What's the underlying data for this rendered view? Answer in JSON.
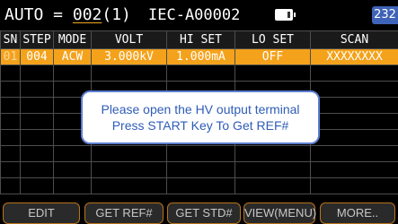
{
  "header": {
    "auto_prefix": "AUTO = ",
    "auto_number": "002",
    "auto_suffix": "(1)",
    "standard": "IEC-A00002",
    "battery_icon": "battery-icon",
    "badge": "232"
  },
  "table": {
    "columns": [
      "SN",
      "STEP",
      "MODE",
      "VOLT",
      "HI SET",
      "LO SET",
      "SCAN"
    ],
    "rows": [
      [
        "01",
        "004",
        "ACW",
        "3.000kV",
        "1.000mA",
        "OFF",
        "XXXXXXXX"
      ]
    ],
    "empty_rows": 8
  },
  "dialog": {
    "line1": "Please open the HV output terminal",
    "line2": "Press START Key To Get REF#"
  },
  "softkeys": [
    "EDIT",
    "GET REF#",
    "GET STD#",
    "VIEW(MENU)",
    "MORE.."
  ],
  "colors": {
    "selected_row": "#f4a21b",
    "badge": "#3f63b8",
    "dialog_border": "#5b7fd1",
    "dialog_text": "#2f5cb8",
    "key_border": "#b8741a"
  }
}
